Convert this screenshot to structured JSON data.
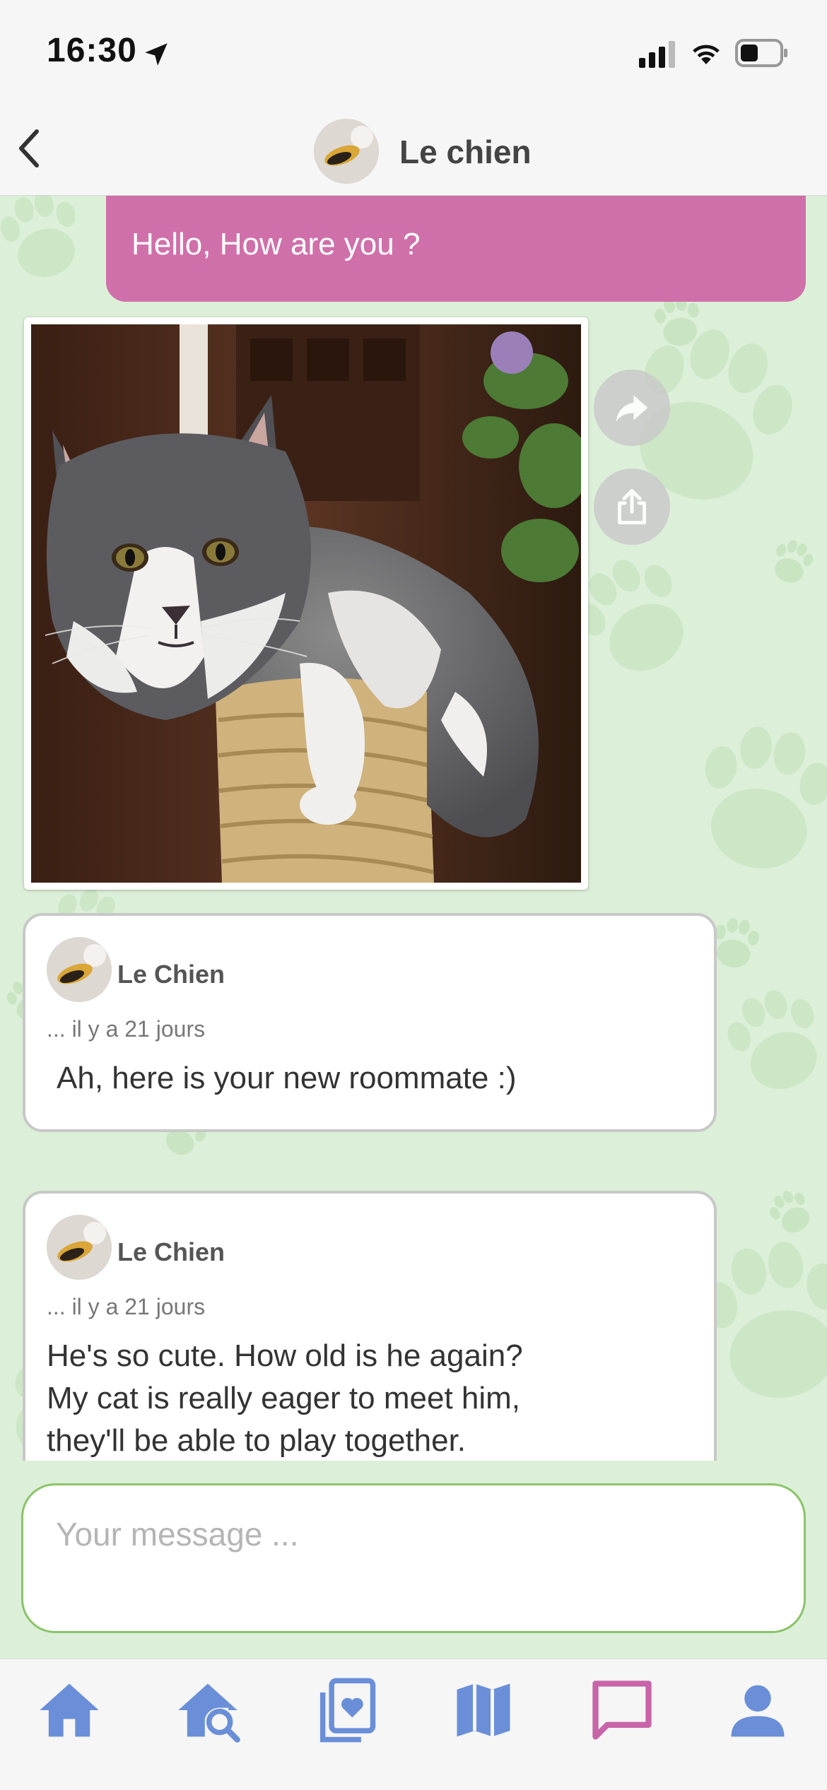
{
  "status_bar": {
    "time": "16:30"
  },
  "header": {
    "title": "Le chien"
  },
  "messages": {
    "sent": {
      "text": "Hello, How are you ?"
    },
    "received": [
      {
        "author": "Le Chien",
        "time": "... il y a 21 jours",
        "lines": [
          "Ah, here is your new roommate :)"
        ]
      },
      {
        "author": "Le Chien",
        "time": "... il y a 21 jours",
        "lines": [
          "He's so cute. How old is he again?",
          "My cat is really eager to meet him,",
          "they'll be able to play together."
        ]
      }
    ]
  },
  "composer": {
    "placeholder": "Your message ...",
    "value": ""
  },
  "tabbar": {
    "items": [
      {
        "icon": "home-icon",
        "active": false
      },
      {
        "icon": "home-search-icon",
        "active": false
      },
      {
        "icon": "photo-heart-icon",
        "active": false
      },
      {
        "icon": "map-icon",
        "active": false
      },
      {
        "icon": "chat-icon",
        "active": true
      },
      {
        "icon": "profile-icon",
        "active": false
      }
    ]
  },
  "colors": {
    "accent": "#d070aa",
    "tab_icon": "#6a8fd8",
    "tab_icon_active": "#c864a8",
    "input_border": "#8bc46a",
    "chat_background": "#dcefd8"
  }
}
